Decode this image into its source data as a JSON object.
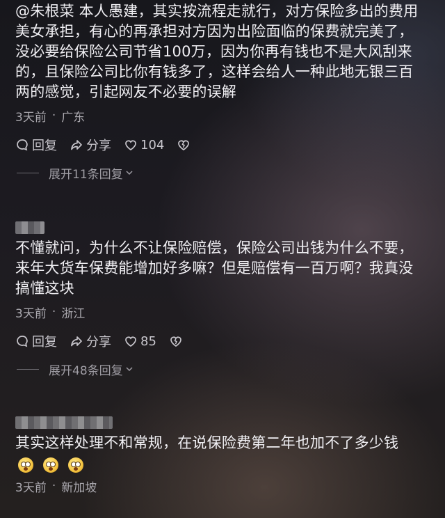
{
  "comments": [
    {
      "text": "@朱根菜 本人愚建，其实按流程走就行，对方保险多出的费用美女承担，有心的再承担对方因为出险面临的保费就完美了，没必要给保险公司节省100万，因为你再有钱也不是大风刮来的，且保险公司比你有钱多了，这样会给人一种此地无银三百两的感觉，引起网友不必要的误解",
      "lines": [
        "@朱根菜 本人愚建，其实按流程走就行，对方保险多出的费用",
        "美女承担，有心的再承担对方因为出险面临的保费就完美了，",
        "没必要给保险公司节省100万，因为你再有钱也不是大风刮来",
        "的，且保险公司比你有钱多了，这样会给人一种此地无银三百",
        "两的感觉，引起网友不必要的误解"
      ],
      "time": "3天前",
      "location": "广东",
      "reply_label": "回复",
      "share_label": "分享",
      "likes": "104",
      "expand_label": "展开11条回复"
    },
    {
      "lines": [
        "不懂就问，为什么不让保险赔偿，保险公司出钱为什么不要，",
        "来年大货车保费能增加好多嘛？但是赔偿有一百万啊？我真没",
        "搞懂这块"
      ],
      "time": "3天前",
      "location": "浙江",
      "reply_label": "回复",
      "share_label": "分享",
      "likes": "85",
      "expand_label": "展开48条回复"
    },
    {
      "lines": [
        "其实这样处理不和常规，在说保险费第二年也加不了多少钱"
      ],
      "emojis": [
        "flushed-face-emoji",
        "flushed-face-emoji",
        "flushed-face-emoji"
      ],
      "time": "3天前",
      "location": "新加坡"
    }
  ],
  "icons": {
    "reply": "chat-bubble-icon",
    "share": "share-arrow-icon",
    "like": "heart-icon",
    "dislike": "broken-heart-icon",
    "expand": "chevron-down-icon"
  },
  "colors": {
    "text": "#f0eff3",
    "meta": "#a9a7ad",
    "action": "#c9c7cd"
  }
}
